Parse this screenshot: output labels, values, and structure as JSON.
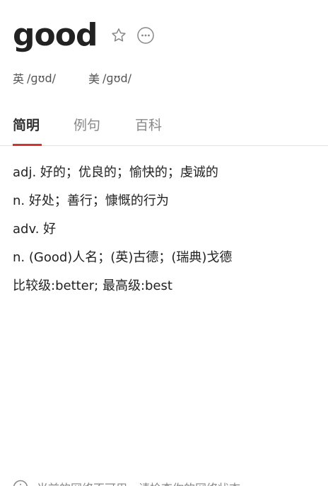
{
  "word": "good",
  "icons": {
    "favorite": "star-outline-icon",
    "more": "more-horizontal-icon",
    "notice": "info-icon"
  },
  "phonetics": {
    "uk": {
      "label": "英",
      "ipa": "/ɡʊd/"
    },
    "us": {
      "label": "美",
      "ipa": "/ɡʊd/"
    }
  },
  "tabs": [
    {
      "label": "简明",
      "active": true
    },
    {
      "label": "例句",
      "active": false
    },
    {
      "label": "百科",
      "active": false
    }
  ],
  "definitions": [
    "adj. 好的；优良的；愉快的；虔诚的",
    "n. 好处；善行；慷慨的行为",
    "adv. 好",
    "n. (Good)人名；(英)古德；(瑞典)戈德",
    "比较级:better; 最高级:best"
  ],
  "footer": {
    "notice": "当前的网络不可用，请检查你的网络状态"
  },
  "colors": {
    "accent": "#d0342c",
    "text": "#222222",
    "muted": "#888888"
  }
}
